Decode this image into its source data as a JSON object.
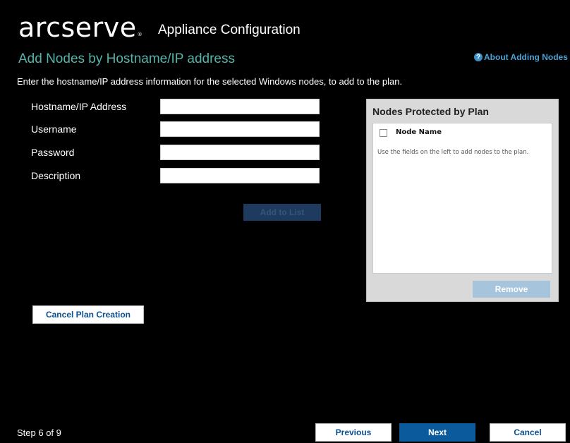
{
  "header": {
    "logo_text": "arcserve",
    "logo_mark": "®",
    "app_title": "Appliance Configuration"
  },
  "page": {
    "title": "Add Nodes by Hostname/IP address",
    "help_link": "About Adding Nodes",
    "instructions": "Enter the hostname/IP address information for the selected Windows nodes, to add to the plan."
  },
  "form": {
    "hostname_label": "Hostname/IP Address",
    "hostname_value": "",
    "username_label": "Username",
    "username_value": "",
    "password_label": "Password",
    "password_value": "",
    "description_label": "Description",
    "description_value": "",
    "add_button": "Add to List"
  },
  "panel": {
    "title": "Nodes Protected by Plan",
    "column_header": "Node Name",
    "empty_message": "Use the fields on the left to add nodes to the plan.",
    "remove_button": "Remove"
  },
  "actions": {
    "cancel_plan": "Cancel Plan Creation"
  },
  "footer": {
    "step": "Step 6 of 9",
    "previous": "Previous",
    "next": "Next",
    "cancel": "Cancel"
  },
  "colors": {
    "background": "#000000",
    "title_accent": "#56b3a9",
    "link": "#4aa3d6",
    "primary_button": "#0b5a9c",
    "disabled_button": "#1e3a5f"
  },
  "icons": {
    "help": "question-circle-icon"
  }
}
